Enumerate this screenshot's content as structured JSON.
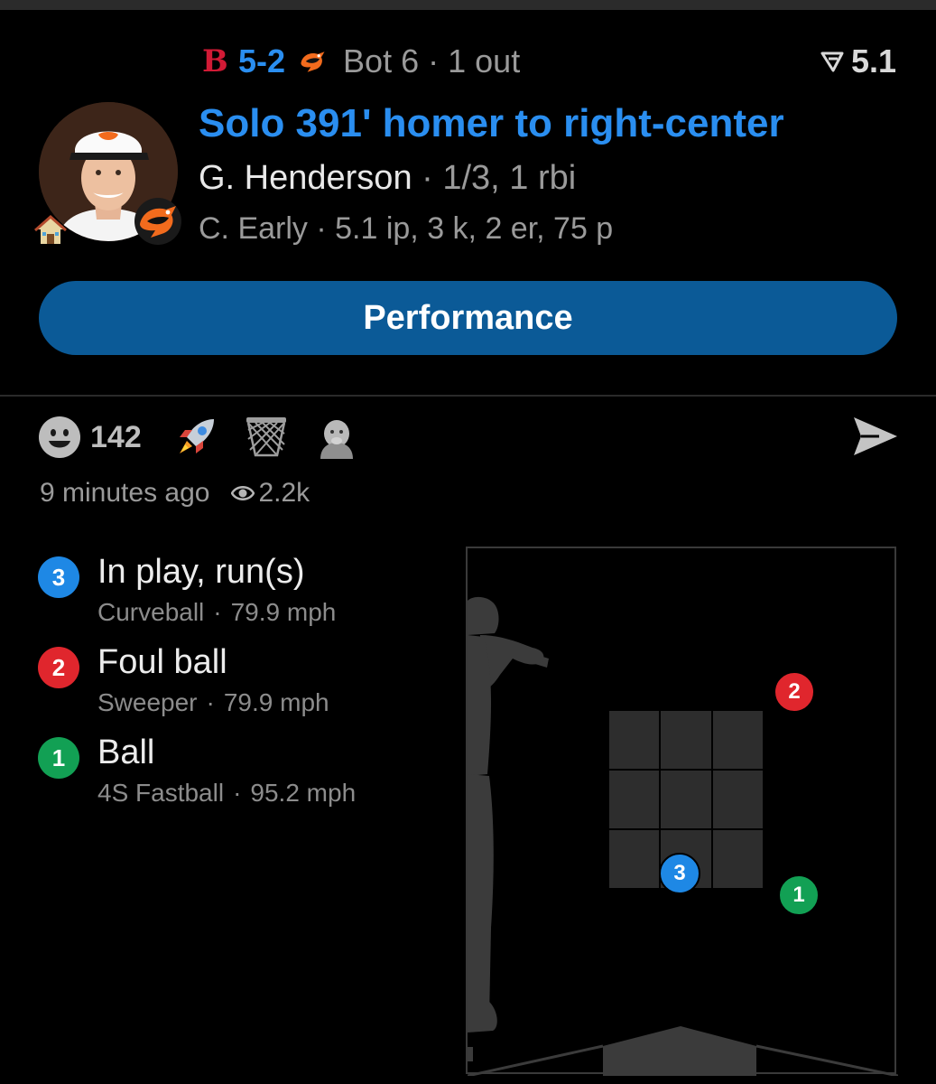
{
  "header": {
    "away_team_glyph": "B",
    "score": "5-2",
    "inning": "Bot 6",
    "separator": "·",
    "outs": "1 out",
    "leverage_value": "5.1",
    "headline": "Solo 391' homer to right-center",
    "batter_name": "G. Henderson",
    "batter_stats": "· 1/3, 1 rbi",
    "pitcher_line": "C. Early · 5.1 ip, 3 k, 2 er, 75 p"
  },
  "performance_button": "Performance",
  "reactions": {
    "count": "142",
    "emojis": [
      "rocket-emoji",
      "basketball-hoop-emoji",
      "baby-emoji"
    ]
  },
  "meta": {
    "time_ago": "9 minutes ago",
    "views": "2.2k"
  },
  "pitches": [
    {
      "num": "3",
      "result": "In play, run(s)",
      "type": "Curveball",
      "speed": "79.9 mph",
      "color": "#1e88e5"
    },
    {
      "num": "2",
      "result": "Foul ball",
      "type": "Sweeper",
      "speed": "79.9 mph",
      "color": "#e0262d"
    },
    {
      "num": "1",
      "result": "Ball",
      "type": "4S Fastball",
      "speed": "95.2 mph",
      "color": "#12a054"
    }
  ],
  "colors": {
    "accent_blue": "#2a8ef0",
    "button_blue": "#0b5a97",
    "red_sox_red": "#d11a35",
    "orioles_orange": "#f26b1d"
  }
}
